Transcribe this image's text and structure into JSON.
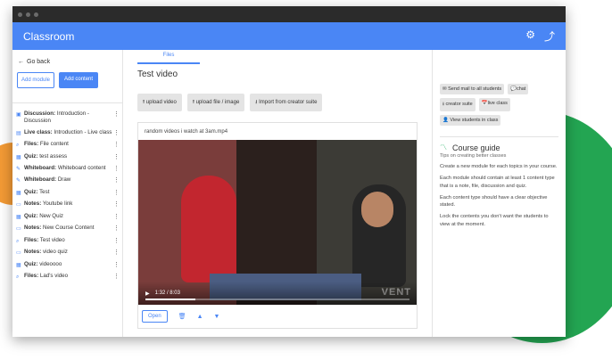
{
  "window": {
    "title": "Classroom"
  },
  "sidebar": {
    "back_label": "Go back",
    "add_module": "Add module",
    "add_content": "Add content",
    "items": [
      {
        "type": "Discussion:",
        "text": "Introduction - Discussion",
        "icon": "discussion-icon"
      },
      {
        "type": "Live class:",
        "text": "Introduction - Live class",
        "icon": "live-icon"
      },
      {
        "type": "Files:",
        "text": "File content",
        "icon": "file-icon"
      },
      {
        "type": "Quiz:",
        "text": "test assess",
        "icon": "quiz-icon"
      },
      {
        "type": "Whiteboard:",
        "text": "Whiteboard content",
        "icon": "pencil-icon"
      },
      {
        "type": "Whiteboard:",
        "text": "Draw",
        "icon": "pencil-icon"
      },
      {
        "type": "Quiz:",
        "text": "Test",
        "icon": "quiz-icon"
      },
      {
        "type": "Notes:",
        "text": "Youtube link",
        "icon": "notes-icon"
      },
      {
        "type": "Quiz:",
        "text": "New Quiz",
        "icon": "quiz-icon"
      },
      {
        "type": "Notes:",
        "text": "New Course Content",
        "icon": "notes-icon"
      },
      {
        "type": "Files:",
        "text": "Test video",
        "icon": "file-icon"
      },
      {
        "type": "Notes:",
        "text": "video quiz",
        "icon": "notes-icon"
      },
      {
        "type": "Quiz:",
        "text": "videoooo",
        "icon": "quiz-icon"
      },
      {
        "type": "Files:",
        "text": "Lad's video",
        "icon": "file-icon"
      }
    ]
  },
  "main": {
    "tab": "Files",
    "title": "Test video",
    "upload_video": "upload video",
    "upload_file": "upload file / image",
    "import_creator": "Import from creator suite",
    "video_caption": "random videos i watch at 3am.mp4",
    "time": "1:32 / 8:03",
    "progress": 0.19,
    "open_label": "Open"
  },
  "right": {
    "send_mail": "Send mail to all students",
    "chat": "chat",
    "creator_suite": "creator suite",
    "live_class": "live class",
    "view_students": "View students in class",
    "guide_title": "Course guide",
    "guide_sub": "Tips on creating better classes",
    "tips": [
      "Create a new module for each topics in your course.",
      "Each module should contain at least 1 content type that is a note, file, discussion and quiz.",
      "Each content type should have a clear objective stated.",
      "Lock the contents you don't want the students to view at the moment."
    ]
  }
}
